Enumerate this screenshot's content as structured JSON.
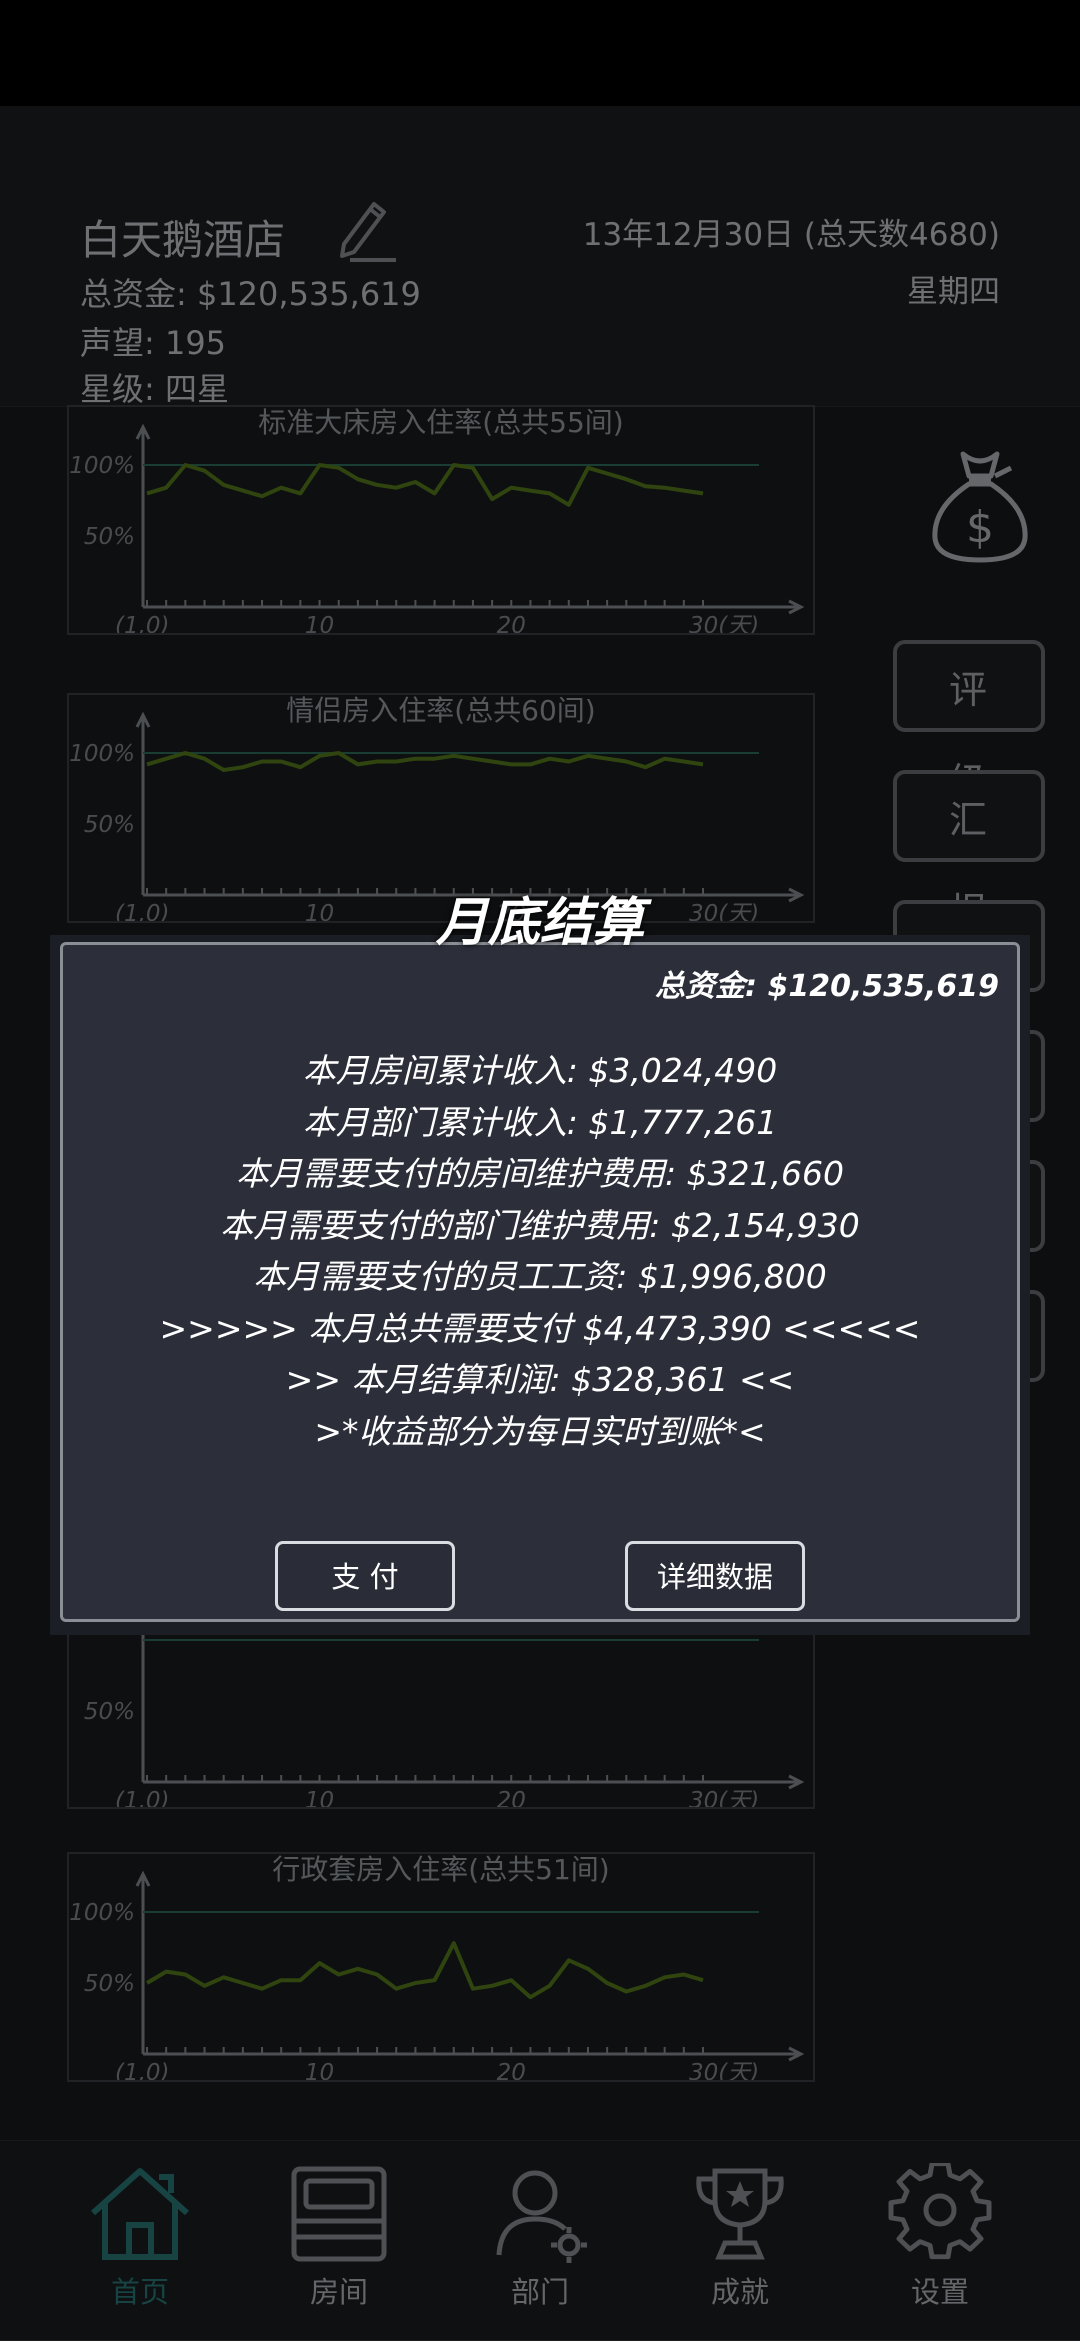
{
  "header": {
    "hotel_name": "白天鹅酒店",
    "funds": "总资金: $120,535,619",
    "reputation": "声望: 195",
    "star_rating": "星级: 四星",
    "date": "13年12月30日 (总天数4680)",
    "weekday": "星期四"
  },
  "side_buttons": [
    "评 级",
    "汇 报"
  ],
  "charts": [
    {
      "title": "标准大床房入住率(总共55间)",
      "tick_labels": {
        "y100": "100%",
        "y50": "50%",
        "x_origin": "(1,0)",
        "x10": "10",
        "x20": "20",
        "x30": "30(天)"
      }
    },
    {
      "title": "情侣房入住率(总共60间)",
      "tick_labels": {
        "y100": "100%",
        "y50": "50%",
        "x_origin": "(1,0)",
        "x10": "10",
        "x20": "20",
        "x30": "30(天)"
      }
    },
    {
      "title": "",
      "tick_labels": {
        "y100": "",
        "y50": "50%",
        "x_origin": "(1,0)",
        "x10": "10",
        "x20": "20",
        "x30": "30(天)"
      }
    },
    {
      "title": "行政套房入住率(总共51间)",
      "tick_labels": {
        "y100": "100%",
        "y50": "50%",
        "x_origin": "(1,0)",
        "x10": "10",
        "x20": "20",
        "x30": "30(天)"
      }
    }
  ],
  "chart_data": [
    {
      "type": "line",
      "title": "标准大床房入住率(总共55间)",
      "xlabel": "天",
      "xlim": [
        1,
        30
      ],
      "ylim": [
        0,
        100
      ],
      "series": [
        {
          "values": [
            80,
            84,
            100,
            96,
            86,
            82,
            78,
            84,
            80,
            100,
            98,
            90,
            86,
            84,
            88,
            80,
            100,
            98,
            76,
            84,
            82,
            80,
            72,
            98,
            94,
            90,
            85,
            84,
            82,
            80
          ]
        }
      ]
    },
    {
      "type": "line",
      "title": "情侣房入住率(总共60间)",
      "xlabel": "天",
      "xlim": [
        1,
        30
      ],
      "ylim": [
        0,
        100
      ],
      "series": [
        {
          "values": [
            92,
            96,
            100,
            96,
            88,
            90,
            94,
            94,
            90,
            98,
            100,
            92,
            94,
            94,
            96,
            96,
            98,
            96,
            94,
            92,
            92,
            96,
            94,
            98,
            96,
            94,
            90,
            96,
            94,
            92
          ]
        }
      ]
    },
    {
      "type": "line",
      "title": "",
      "xlabel": "天",
      "xlim": [
        1,
        30
      ],
      "ylim": [
        0,
        100
      ]
    },
    {
      "type": "line",
      "title": "行政套房入住率(总共51间)",
      "xlabel": "天",
      "xlim": [
        1,
        30
      ],
      "ylim": [
        0,
        100
      ],
      "series": [
        {
          "values": [
            50,
            58,
            56,
            48,
            54,
            50,
            46,
            52,
            52,
            64,
            56,
            60,
            56,
            46,
            50,
            52,
            78,
            46,
            48,
            52,
            40,
            48,
            66,
            60,
            50,
            44,
            48,
            54,
            56,
            52
          ]
        }
      ]
    }
  ],
  "modal": {
    "title": "月底结算",
    "total_funds": "总资金: $120,535,619",
    "lines": [
      "本月房间累计收入: $3,024,490",
      "本月部门累计收入: $1,777,261",
      "本月需要支付的房间维护费用: $321,660",
      "本月需要支付的部门维护费用: $2,154,930",
      "本月需要支付的员工工资: $1,996,800",
      ">>>>> 本月总共需要支付 $4,473,390 <<<<<",
      ">> 本月结算利润: $328,361 <<",
      ">*收益部分为每日实时到账*<"
    ],
    "pay_button": "支 付",
    "details_button": "详细数据"
  },
  "nav": [
    {
      "label": "首页",
      "icon": "home-icon",
      "active": true
    },
    {
      "label": "房间",
      "icon": "bed-icon",
      "active": false
    },
    {
      "label": "部门",
      "icon": "staff-icon",
      "active": false
    },
    {
      "label": "成就",
      "icon": "trophy-icon",
      "active": false
    },
    {
      "label": "设置",
      "icon": "gear-icon",
      "active": false
    }
  ],
  "colors": {
    "accent": "#2b7b7a",
    "series_line": "#567c1a",
    "full_line": "#2f6e5e"
  }
}
